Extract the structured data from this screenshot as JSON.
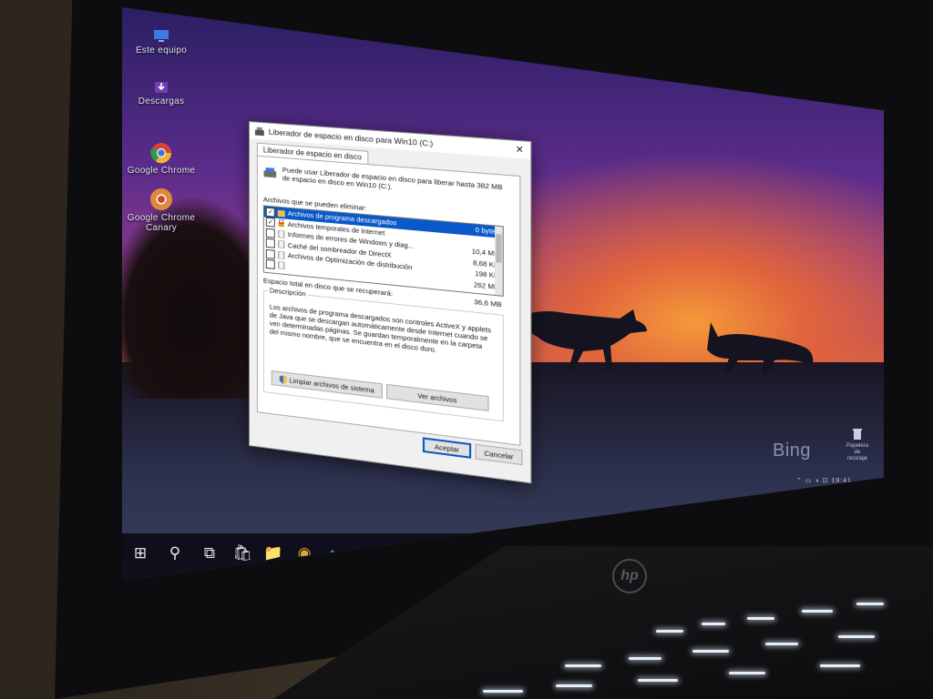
{
  "desktop": {
    "icons": [
      {
        "label": "Este equipo",
        "icon": "computer-icon"
      },
      {
        "label": "Descargas",
        "icon": "downloads-folder-icon"
      },
      {
        "label": "Google Chrome",
        "icon": "chrome-icon"
      },
      {
        "label": "Google Chrome Canary",
        "icon": "chrome-canary-icon"
      }
    ],
    "wallpaper_brand": "Bing",
    "recycle_bin_label": "Papelera de reciclaje"
  },
  "dialog": {
    "title": "Liberador de espacio en disco para Win10 (C:)",
    "close_glyph": "✕",
    "tab_label": "Liberador de espacio en disco",
    "intro": "Puede usar Liberador de espacio en disco para liberar hasta 382 MB de espacio en disco en Win10 (C:).",
    "files_label": "Archivos que se pueden eliminar:",
    "files": [
      {
        "name": "Archivos de programa descargados",
        "size": "0 bytes",
        "checked": true,
        "selected": true
      },
      {
        "name": "Archivos temporales de Internet",
        "size": "",
        "checked": true,
        "selected": false
      },
      {
        "name": "Informes de errores de Windows y diag...",
        "size": "10,4 MB",
        "checked": false,
        "selected": false
      },
      {
        "name": "Caché del sombreador de DirectX",
        "size": "8,68 KB",
        "checked": false,
        "selected": false
      },
      {
        "name": "Archivos de Optimización de distribución",
        "size": "198 KB",
        "checked": false,
        "selected": false
      },
      {
        "name": "",
        "size": "262 MB",
        "checked": false,
        "selected": false
      }
    ],
    "total_label": "Espacio total en disco que se recuperará:",
    "total_value": "36,6 MB",
    "description_title": "Descripción",
    "description": "Los archivos de programa descargados son controles ActiveX y applets de Java que se descargan automáticamente desde Internet cuando se ven determinadas páginas. Se guardan temporalmente en la carpeta del mismo nombre, que se encuentra en el disco duro.",
    "clean_system_button": "Limpiar archivos de sistema",
    "view_files_button": "Ver archivos",
    "ok_button": "Aceptar",
    "cancel_button": "Cancelar"
  },
  "taskbar": {
    "items": [
      {
        "icon": "windows-start-icon",
        "glyph": "⊞"
      },
      {
        "icon": "search-icon",
        "glyph": "⚲"
      },
      {
        "icon": "task-view-icon",
        "glyph": "⧉"
      },
      {
        "icon": "store-icon",
        "glyph": "🛍"
      },
      {
        "icon": "file-explorer-icon",
        "glyph": "📁"
      },
      {
        "icon": "chrome-icon",
        "glyph": "◉"
      },
      {
        "icon": "edge-icon",
        "glyph": "◐"
      },
      {
        "icon": "edge-beta-icon",
        "glyph": "◐"
      },
      {
        "icon": "edge-dev-icon",
        "glyph": "◐"
      },
      {
        "icon": "edge-canary-icon",
        "glyph": "◐"
      },
      {
        "icon": "disk-cleanup-icon",
        "glyph": "▭"
      }
    ],
    "tray_time": "19:41"
  },
  "laptop": {
    "brand": "hp"
  },
  "colors": {
    "accent": "#0a59c9",
    "dialog_bg": "#f0f0f0",
    "taskbar_bg": "#0c0c16"
  }
}
